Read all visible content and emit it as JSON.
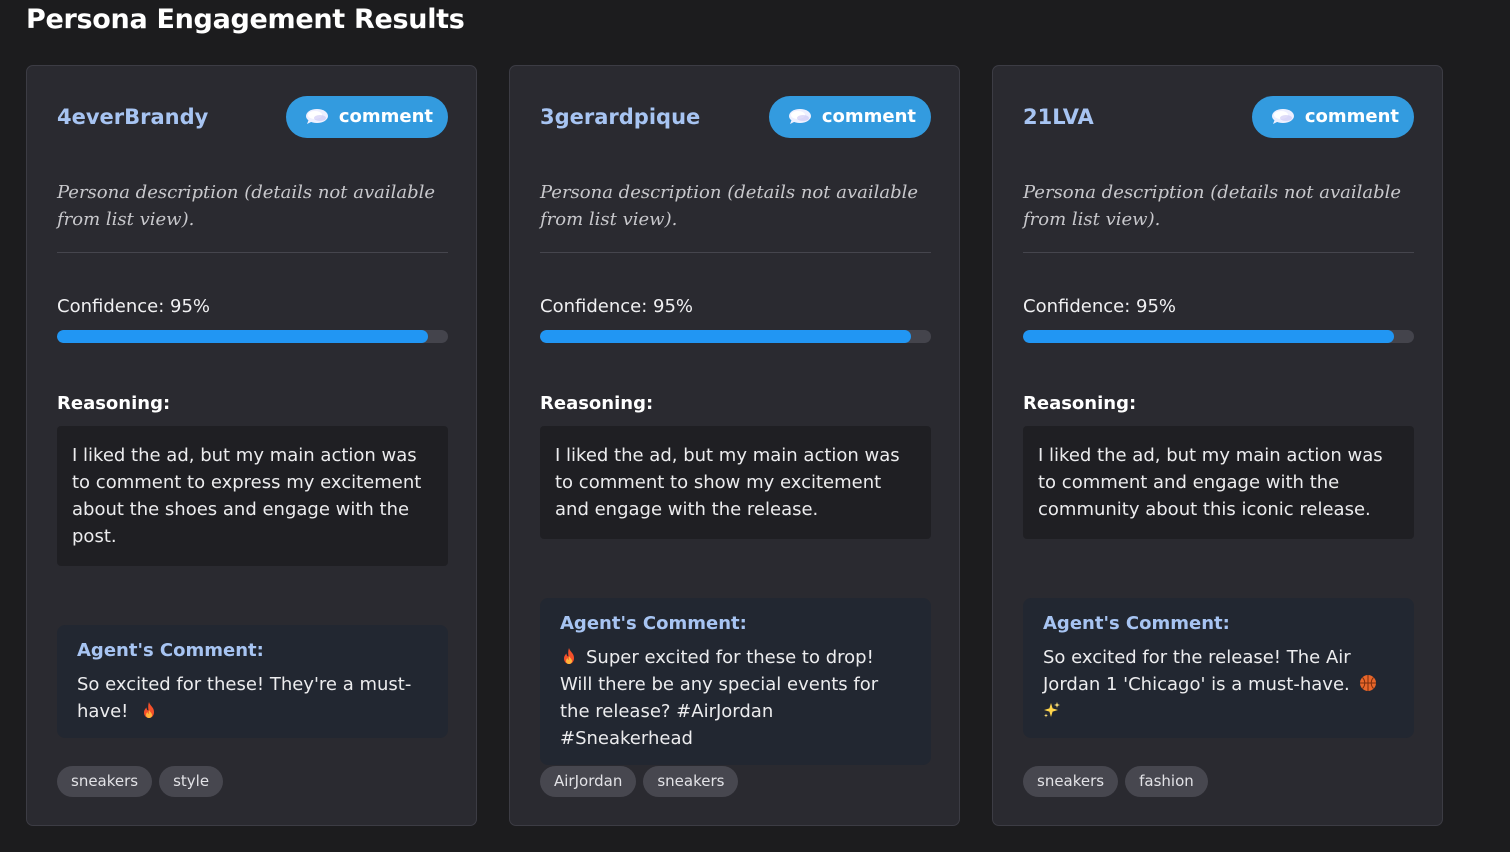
{
  "page": {
    "title": "Persona Engagement Results"
  },
  "colors": {
    "background": "#1c1c1e",
    "card": "#2a2a30",
    "accent_blue": "#339bdf",
    "confidence_fill": "#2196f3",
    "persona_name": "#a7c4f2",
    "comment_box": "#222731",
    "tag_bg": "#47474f"
  },
  "cards": [
    {
      "name": "4everBrandy",
      "action": {
        "label": "comment",
        "icon": "speech-bubble-icon"
      },
      "description": "Persona description (details not available from list view).",
      "confidence": {
        "label": "Confidence: 95%",
        "value": 0.95
      },
      "reasoning": {
        "heading": "Reasoning:",
        "text": "I liked the ad, but my main action was to comment to express my excitement about the shoes and engage with the post."
      },
      "comment": {
        "heading": "Agent's Comment:",
        "text": "So excited for these! They're a must-have!",
        "emojis": [
          "fire-icon"
        ]
      },
      "tags": [
        "sneakers",
        "style"
      ]
    },
    {
      "name": "3gerardpique",
      "action": {
        "label": "comment",
        "icon": "speech-bubble-icon"
      },
      "description": "Persona description (details not available from list view).",
      "confidence": {
        "label": "Confidence: 95%",
        "value": 0.95
      },
      "reasoning": {
        "heading": "Reasoning:",
        "text": "I liked the ad, but my main action was to comment to show my excitement and engage with the release."
      },
      "comment": {
        "heading": "Agent's Comment:",
        "text": "Super excited for these to drop! Will there be any special events for the release? #AirJordan #Sneakerhead",
        "emojis": [
          "fire-icon"
        ]
      },
      "tags": [
        "AirJordan",
        "sneakers"
      ]
    },
    {
      "name": "21LVA",
      "action": {
        "label": "comment",
        "icon": "speech-bubble-icon"
      },
      "description": "Persona description (details not available from list view).",
      "confidence": {
        "label": "Confidence: 95%",
        "value": 0.95
      },
      "reasoning": {
        "heading": "Reasoning:",
        "text": "I liked the ad, but my main action was to comment and engage with the community about this iconic release."
      },
      "comment": {
        "heading": "Agent's Comment:",
        "text": "So excited for the release! The Air Jordan 1 'Chicago' is a must-have.",
        "emojis": [
          "basketball-icon",
          "sparkles-icon"
        ]
      },
      "tags": [
        "sneakers",
        "fashion"
      ]
    }
  ]
}
